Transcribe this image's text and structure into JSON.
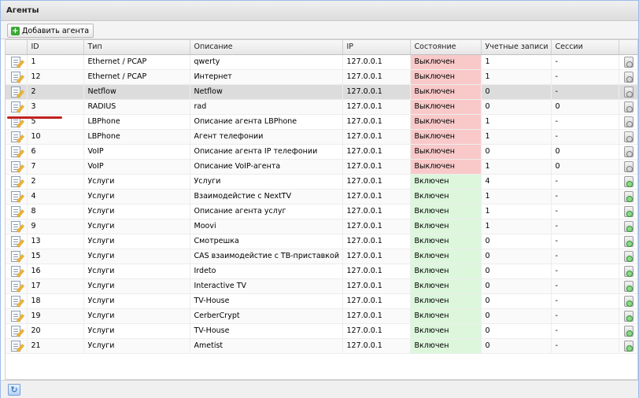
{
  "panel": {
    "title": "Агенты"
  },
  "toolbar": {
    "add_label": "Добавить агента"
  },
  "columns": [
    "ID",
    "Тип",
    "Описание",
    "IP",
    "Состояние",
    "Учетные записи",
    "Сессии"
  ],
  "rows": [
    {
      "id": "1",
      "type": "Ethernet / PCAP",
      "desc": "qwerty",
      "ip": "127.0.0.1",
      "state": "Выключен",
      "accounts": "1",
      "sessions": "-"
    },
    {
      "id": "12",
      "type": "Ethernet / PCAP",
      "desc": "Интернет",
      "ip": "127.0.0.1",
      "state": "Выключен",
      "accounts": "1",
      "sessions": "-"
    },
    {
      "id": "2",
      "type": "Netflow",
      "desc": "Netflow",
      "ip": "127.0.0.1",
      "state": "Выключен",
      "accounts": "0",
      "sessions": "-"
    },
    {
      "id": "3",
      "type": "RADIUS",
      "desc": "rad",
      "ip": "127.0.0.1",
      "state": "Выключен",
      "accounts": "0",
      "sessions": "0"
    },
    {
      "id": "5",
      "type": "LBPhone",
      "desc": "Описание агента LBPhone",
      "ip": "127.0.0.1",
      "state": "Выключен",
      "accounts": "1",
      "sessions": "-"
    },
    {
      "id": "10",
      "type": "LBPhone",
      "desc": "Агент телефонии",
      "ip": "127.0.0.1",
      "state": "Выключен",
      "accounts": "1",
      "sessions": "-"
    },
    {
      "id": "6",
      "type": "VoIP",
      "desc": "Описание агента IP телефонии",
      "ip": "127.0.0.1",
      "state": "Выключен",
      "accounts": "0",
      "sessions": "0"
    },
    {
      "id": "7",
      "type": "VoIP",
      "desc": "Описание VoIP-агента",
      "ip": "127.0.0.1",
      "state": "Выключен",
      "accounts": "1",
      "sessions": "0"
    },
    {
      "id": "2",
      "type": "Услуги",
      "desc": "Услуги",
      "ip": "127.0.0.1",
      "state": "Включен",
      "accounts": "4",
      "sessions": "-"
    },
    {
      "id": "4",
      "type": "Услуги",
      "desc": "Взаимодейстие с NextTV",
      "ip": "127.0.0.1",
      "state": "Включен",
      "accounts": "1",
      "sessions": "-"
    },
    {
      "id": "8",
      "type": "Услуги",
      "desc": "Описание агента услуг",
      "ip": "127.0.0.1",
      "state": "Включен",
      "accounts": "1",
      "sessions": "-"
    },
    {
      "id": "9",
      "type": "Услуги",
      "desc": "Moovi",
      "ip": "127.0.0.1",
      "state": "Включен",
      "accounts": "1",
      "sessions": "-"
    },
    {
      "id": "13",
      "type": "Услуги",
      "desc": "Смотрешка",
      "ip": "127.0.0.1",
      "state": "Включен",
      "accounts": "0",
      "sessions": "-"
    },
    {
      "id": "15",
      "type": "Услуги",
      "desc": "CAS взаимодейстие с ТВ-приставкой",
      "ip": "127.0.0.1",
      "state": "Включен",
      "accounts": "0",
      "sessions": "-"
    },
    {
      "id": "16",
      "type": "Услуги",
      "desc": "Irdeto",
      "ip": "127.0.0.1",
      "state": "Включен",
      "accounts": "0",
      "sessions": "-"
    },
    {
      "id": "17",
      "type": "Услуги",
      "desc": "Interactive TV",
      "ip": "127.0.0.1",
      "state": "Включен",
      "accounts": "0",
      "sessions": "-"
    },
    {
      "id": "18",
      "type": "Услуги",
      "desc": "TV-House",
      "ip": "127.0.0.1",
      "state": "Включен",
      "accounts": "0",
      "sessions": "-"
    },
    {
      "id": "19",
      "type": "Услуги",
      "desc": "CerberCrypt",
      "ip": "127.0.0.1",
      "state": "Включен",
      "accounts": "0",
      "sessions": "-"
    },
    {
      "id": "20",
      "type": "Услуги",
      "desc": "TV-House",
      "ip": "127.0.0.1",
      "state": "Включен",
      "accounts": "0",
      "sessions": "-"
    },
    {
      "id": "21",
      "type": "Услуги",
      "desc": "Ametist",
      "ip": "127.0.0.1",
      "state": "Включен",
      "accounts": "0",
      "sessions": "-"
    }
  ],
  "selected_row_index": 2,
  "colors": {
    "state_off": "#f9c9c9",
    "state_on": "#ddf7dd",
    "selected": "#dcdcdc",
    "marker": "#c0221f"
  },
  "icons": {
    "add": "plus-icon",
    "edit": "edit-icon",
    "action": "toggle-icon",
    "refresh": "refresh-icon"
  }
}
